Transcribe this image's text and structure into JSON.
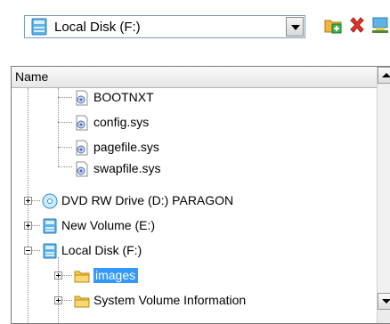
{
  "toolbar": {
    "drive_selector": {
      "selected": "Local Disk (F:)",
      "icon": "hard-drive-icon"
    },
    "buttons": [
      {
        "name": "new-folder-button",
        "icon": "folder-add-icon"
      },
      {
        "name": "delete-button",
        "icon": "red-x-icon"
      },
      {
        "name": "map-drive-button",
        "icon": "network-drive-icon"
      }
    ]
  },
  "tree": {
    "column_header": "Name",
    "items": [
      {
        "label": "BOOTNXT",
        "icon": "system-file-icon"
      },
      {
        "label": "config.sys",
        "icon": "system-file-icon"
      },
      {
        "label": "pagefile.sys",
        "icon": "system-file-icon"
      },
      {
        "label": "swapfile.sys",
        "icon": "system-file-icon"
      },
      {
        "label": "DVD RW Drive (D:) PARAGON",
        "icon": "optical-drive-icon",
        "expander": "plus"
      },
      {
        "label": "New Volume (E:)",
        "icon": "hard-drive-icon",
        "expander": "plus"
      },
      {
        "label": "Local Disk (F:)",
        "icon": "hard-drive-icon",
        "expander": "minus"
      },
      {
        "label": "images",
        "icon": "folder-icon",
        "expander": "plus",
        "selected": true
      },
      {
        "label": "System Volume Information",
        "icon": "folder-icon",
        "expander": "plus"
      }
    ]
  },
  "colors": {
    "selection": "#3399ff",
    "drive_blue": "#4aa3df",
    "folder_yellow": "#f2c94c"
  }
}
